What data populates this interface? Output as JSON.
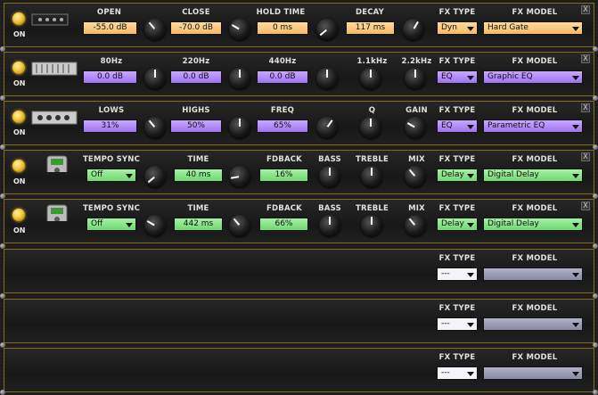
{
  "common": {
    "on_label": "ON",
    "fx_type_label": "FX TYPE",
    "fx_model_label": "FX MODEL",
    "close_glyph": "X",
    "power_color": "#f6c633",
    "frame_color": "#8a6b1c"
  },
  "slots": [
    {
      "fx_type": "Dyn",
      "fx_model": "Hard Gate",
      "labels": [
        "OPEN",
        "CLOSE",
        "HOLD TIME",
        "DECAY"
      ],
      "values": [
        "-55.0 dB",
        "-70.0 dB",
        "0 ms",
        "117 ms"
      ],
      "color": "orange"
    },
    {
      "fx_type": "EQ",
      "fx_model": "Graphic EQ",
      "labels": [
        "80Hz",
        "220Hz",
        "440Hz",
        "1.1kHz",
        "2.2kHz"
      ],
      "values": [
        "0.0 dB",
        "0.0 dB",
        "0.0 dB"
      ],
      "color": "purple"
    },
    {
      "fx_type": "EQ",
      "fx_model": "Parametric EQ",
      "labels": [
        "LOWS",
        "HIGHS",
        "FREQ",
        "Q",
        "GAIN"
      ],
      "values": [
        "31%",
        "50%",
        "65%"
      ],
      "color": "purple"
    },
    {
      "fx_type": "Delay",
      "fx_model": "Digital Delay",
      "labels": [
        "TEMPO SYNC",
        "TIME",
        "FDBACK",
        "BASS",
        "TREBLE",
        "MIX"
      ],
      "values": [
        "Off",
        "40 ms",
        "16%"
      ],
      "color": "green"
    },
    {
      "fx_type": "Delay",
      "fx_model": "Digital Delay",
      "labels": [
        "TEMPO SYNC",
        "TIME",
        "FDBACK",
        "BASS",
        "TREBLE",
        "MIX"
      ],
      "values": [
        "Off",
        "442 ms",
        "66%"
      ],
      "color": "green"
    },
    {
      "fx_type": "---",
      "fx_model": ""
    },
    {
      "fx_type": "---",
      "fx_model": ""
    },
    {
      "fx_type": "---",
      "fx_model": ""
    }
  ]
}
